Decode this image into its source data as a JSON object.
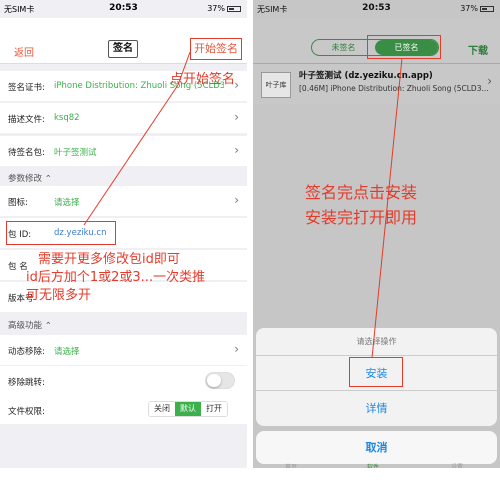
{
  "left": {
    "status": {
      "carrier": "无SIM卡",
      "time": "20:53",
      "battery": "37%"
    },
    "nav": {
      "back": "返回",
      "title": "签名",
      "start": "开始签名"
    },
    "rows": {
      "cert_label": "签名证书:",
      "cert_value": "iPhone Distribution: Zhuoli Song (5CLD37...",
      "profile_label": "描述文件:",
      "profile_value": "ksq82",
      "pending_label": "待签名包:",
      "pending_value": "叶子签测试",
      "params_section": "参数修改 ⌃",
      "icon_label": "图标:",
      "icon_value": "请选择",
      "bundle_label": "包 ID:",
      "bundle_value": "dz.yeziku.cn",
      "name_label": "包 名",
      "version_label": "版本号",
      "advanced_section": "高级功能 ⌃",
      "dynlib_label": "动态移除:",
      "dynlib_value": "请选择",
      "jump_label": "移除跳转:",
      "perm_label": "文件权限:",
      "perm_options": [
        "关闭",
        "默认",
        "打开"
      ]
    },
    "annotations": {
      "start_hint": "点开始签名",
      "multi_line1": "需要开更多修改包id即可",
      "multi_line2": "id后方加个1或2或3...一次类推",
      "multi_line3": "可无限多开"
    }
  },
  "right": {
    "status": {
      "carrier": "无SIM卡",
      "time": "20:53",
      "battery": "37%"
    },
    "tabs": [
      "未签名",
      "已签名"
    ],
    "download": "下载",
    "app": {
      "logo": "叶子库",
      "title": "叶子签测试 (dz.yeziku.cn.app)",
      "subtitle": "[0.46M] iPhone Distribution: Zhuoli Song (5CLD3..."
    },
    "annotations": {
      "line1": "签名完点击安装",
      "line2": "安装完打开即用"
    },
    "sheet": {
      "title": "请选择操作",
      "install": "安装",
      "detail": "详情",
      "cancel": "取消"
    },
    "tabbar": {
      "left": "首页",
      "mid": "软件",
      "right": "设置"
    }
  },
  "colors": {
    "accent_green": "#3bb04c",
    "annotation_red": "#e43b2b",
    "link_blue": "#1e88e5"
  }
}
